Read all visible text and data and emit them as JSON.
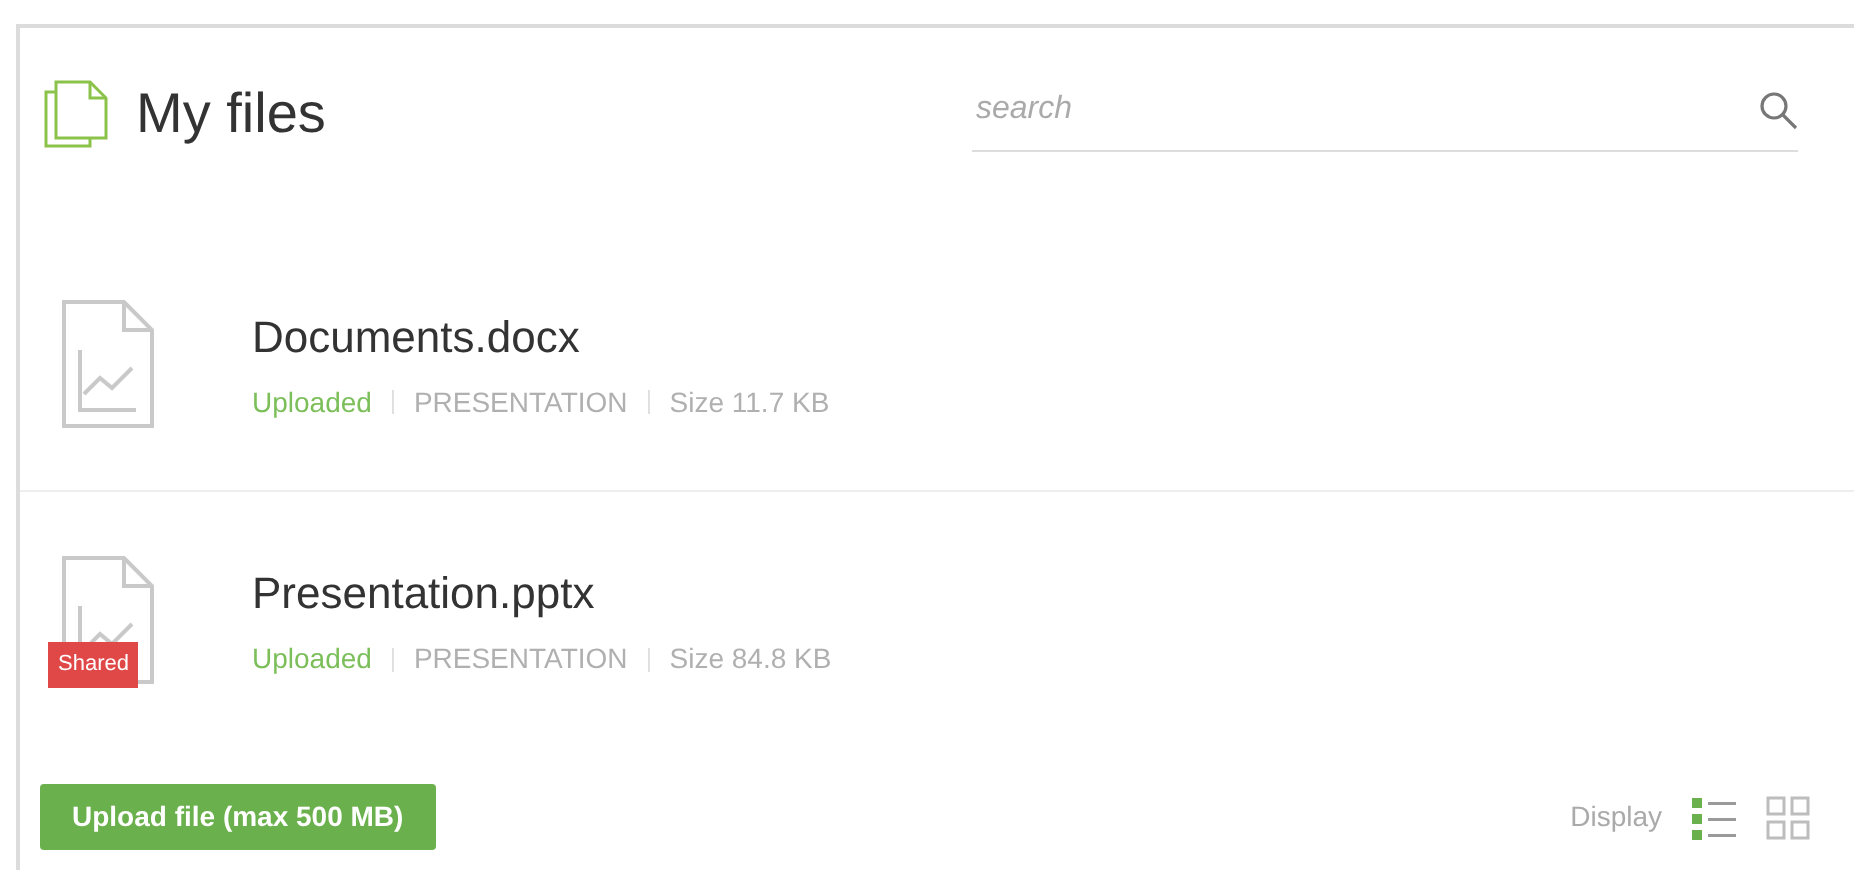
{
  "header": {
    "title": "My files",
    "search": {
      "placeholder": "search"
    }
  },
  "files": [
    {
      "name": "Documents.docx",
      "status": "Uploaded",
      "type": "PRESENTATION",
      "size": "Size 11.7 KB",
      "shared": false
    },
    {
      "name": "Presentation.pptx",
      "status": "Uploaded",
      "type": "PRESENTATION",
      "size": "Size 84.8 KB",
      "shared": true,
      "badge": "Shared"
    }
  ],
  "footer": {
    "upload_button": "Upload file (max 500 MB)",
    "display_label": "Display",
    "views": [
      {
        "kind": "list",
        "selected": true
      },
      {
        "kind": "grid",
        "selected": false
      }
    ]
  }
}
